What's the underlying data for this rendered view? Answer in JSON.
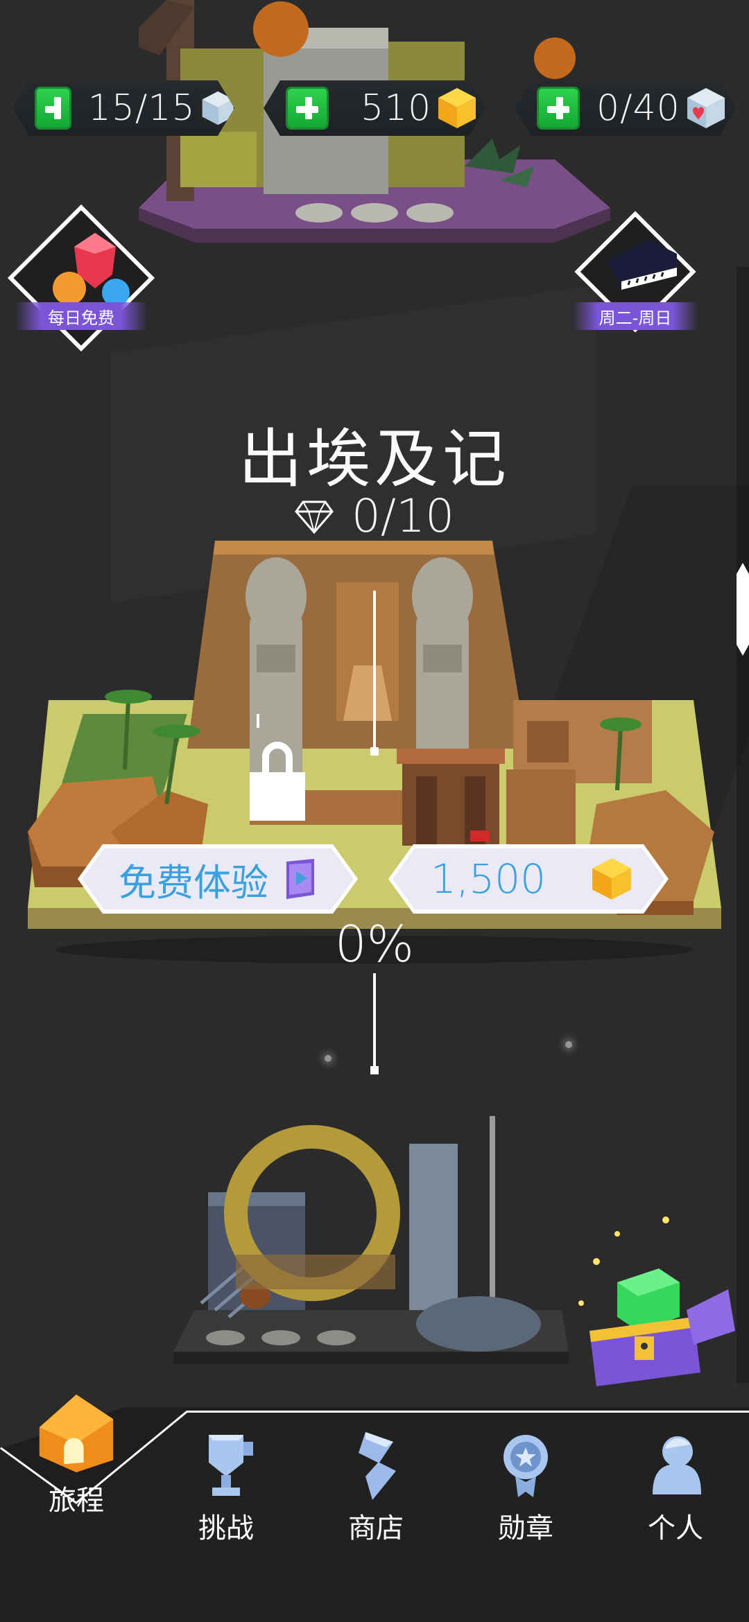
{
  "currency": {
    "energy": {
      "value": "15/15",
      "icon": "ice-cube-icon"
    },
    "coins": {
      "value": "510",
      "icon": "gold-cube-icon"
    },
    "hearts": {
      "value": "0/40",
      "icon": "heart-cube-icon"
    }
  },
  "badges": {
    "daily": {
      "label": "每日免费",
      "icon": "gems-icon"
    },
    "piano": {
      "label": "周二-周日",
      "icon": "piano-icon"
    }
  },
  "level": {
    "title": "出埃及记",
    "gems": "0/10",
    "progress": "0%",
    "progress_value": 0,
    "free_trial_label": "免费体验",
    "price": "1,500"
  },
  "nav": {
    "items": [
      {
        "label": "旅程",
        "icon": "house-icon",
        "active": true
      },
      {
        "label": "挑战",
        "icon": "trophy-icon"
      },
      {
        "label": "商店",
        "icon": "shop-icon"
      },
      {
        "label": "勋章",
        "icon": "medal-icon"
      },
      {
        "label": "个人",
        "icon": "person-icon"
      }
    ]
  },
  "colors": {
    "background": "#2b2b2c",
    "accent_blue": "#3aa0de",
    "badge_purple": "#7b55d8",
    "green_plus": "#22c043",
    "gold": "#f7b21a"
  }
}
